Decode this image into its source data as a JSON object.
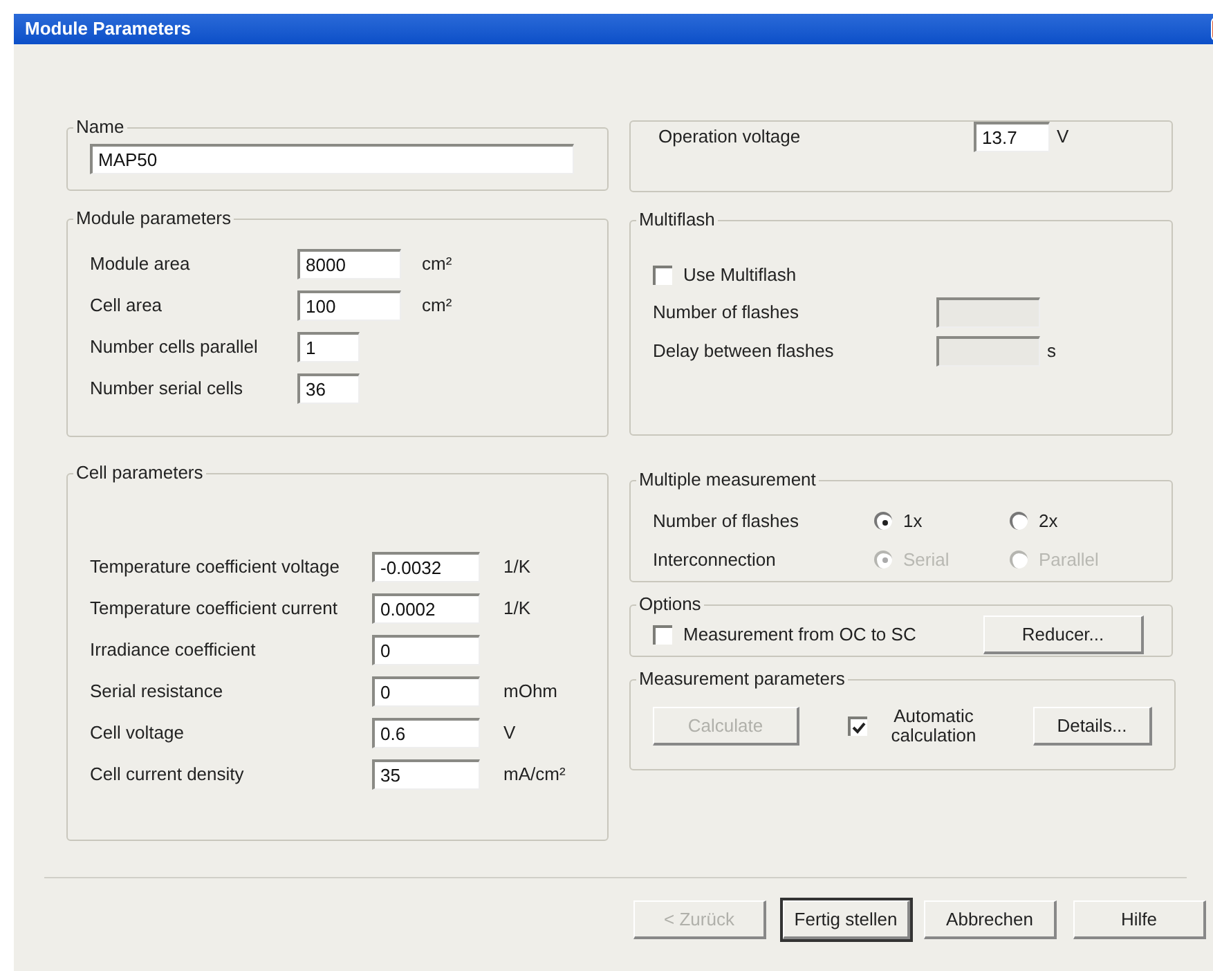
{
  "window": {
    "title": "Module Parameters"
  },
  "name_group": {
    "label": "Name",
    "value": "MAP50"
  },
  "operation_voltage": {
    "label": "Operation voltage",
    "value": "13.7",
    "unit": "V"
  },
  "module_parameters": {
    "title": "Module parameters",
    "rows": [
      {
        "label": "Module area",
        "value": "8000",
        "unit": "cm²"
      },
      {
        "label": "Cell area",
        "value": "100",
        "unit": "cm²"
      },
      {
        "label": "Number cells parallel",
        "value": "1"
      },
      {
        "label": "Number serial cells",
        "value": "36"
      }
    ]
  },
  "cell_parameters": {
    "title": "Cell parameters",
    "rows": [
      {
        "label": "Temperature coefficient voltage",
        "value": "-0.0032",
        "unit": "1/K"
      },
      {
        "label": "Temperature coefficient current",
        "value": "0.0002",
        "unit": "1/K"
      },
      {
        "label": "Irradiance coefficient",
        "value": "0"
      },
      {
        "label": "Serial resistance",
        "value": "0",
        "unit": "mOhm"
      },
      {
        "label": "Cell voltage",
        "value": "0.6",
        "unit": "V"
      },
      {
        "label": "Cell current density",
        "value": "35",
        "unit": "mA/cm²"
      }
    ]
  },
  "multiflash": {
    "title": "Multiflash",
    "checkbox": {
      "label": "Use Multiflash",
      "checked": false
    },
    "rows": [
      {
        "label": "Number of flashes",
        "disabled": true
      },
      {
        "label": "Delay between flashes",
        "unit": "s",
        "disabled": true
      }
    ]
  },
  "multiple_measurement": {
    "title": "Multiple measurement",
    "rows": [
      {
        "label": "Number of flashes",
        "options": [
          {
            "label": "1x",
            "selected": true,
            "disabled": false
          },
          {
            "label": "2x",
            "selected": false,
            "disabled": false
          }
        ]
      },
      {
        "label": "Interconnection",
        "options": [
          {
            "label": "Serial",
            "selected": true,
            "disabled": true
          },
          {
            "label": "Parallel",
            "selected": false,
            "disabled": true
          }
        ]
      }
    ]
  },
  "options": {
    "title": "Options",
    "checkbox": {
      "label": "Measurement from OC to SC",
      "checked": false
    },
    "button": {
      "label": "Reducer...",
      "disabled": false
    }
  },
  "measurement_parameters": {
    "title": "Measurement parameters",
    "calculate_button": {
      "label": "Calculate",
      "disabled": true
    },
    "checkbox": {
      "label": "Automatic calculation",
      "checked": true
    },
    "details_button": {
      "label": "Details...",
      "disabled": false
    }
  },
  "buttons": [
    {
      "label": "< Zurück",
      "disabled": true,
      "default": false
    },
    {
      "label": "Fertig stellen",
      "disabled": false,
      "default": true
    },
    {
      "label": "Abbrechen",
      "disabled": false,
      "default": false
    },
    {
      "label": "Hilfe",
      "disabled": false,
      "default": false
    }
  ]
}
